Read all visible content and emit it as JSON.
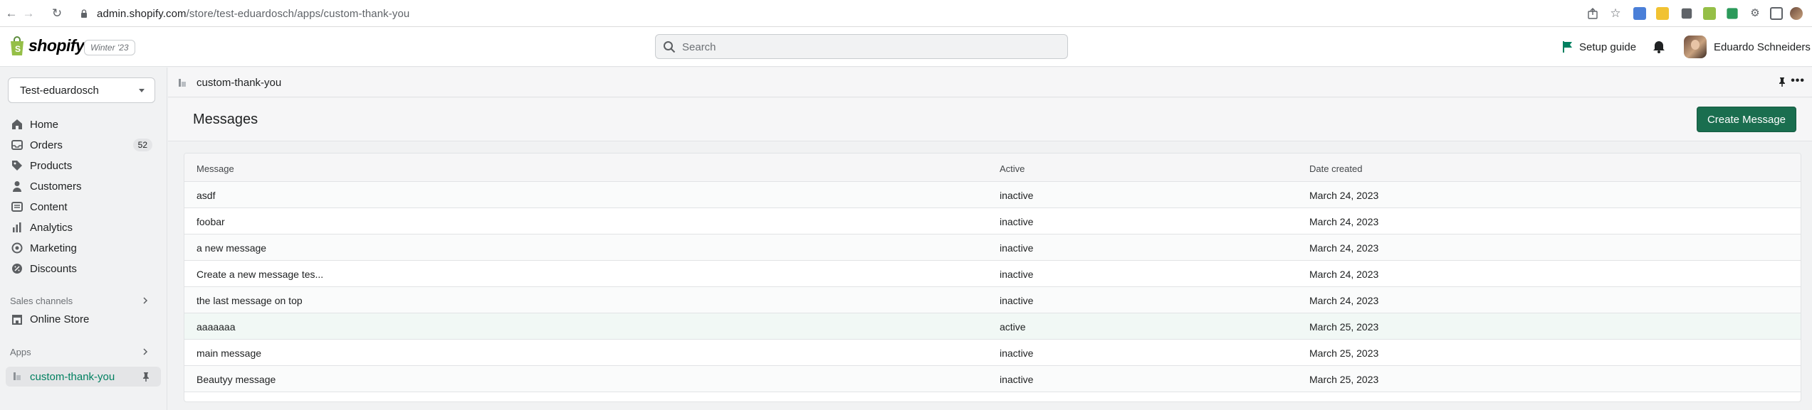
{
  "browser": {
    "url_host": "admin.shopify.com",
    "url_path": "/store/test-eduardosch/apps/custom-thank-you"
  },
  "topbar": {
    "logo_text": "shopify",
    "version_badge": "Winter '23",
    "search_placeholder": "Search",
    "setup_guide_label": "Setup guide",
    "user_name": "Eduardo Schneiders"
  },
  "sidebar": {
    "store_name": "Test-eduardosch",
    "items": [
      {
        "label": "Home",
        "icon": "home-icon"
      },
      {
        "label": "Orders",
        "icon": "orders-icon",
        "count": "52"
      },
      {
        "label": "Products",
        "icon": "tag-icon"
      },
      {
        "label": "Customers",
        "icon": "person-icon"
      },
      {
        "label": "Content",
        "icon": "content-icon"
      },
      {
        "label": "Analytics",
        "icon": "bar-chart-icon"
      },
      {
        "label": "Marketing",
        "icon": "target-icon"
      },
      {
        "label": "Discounts",
        "icon": "discount-icon"
      }
    ],
    "sales_channels_label": "Sales channels",
    "online_store_label": "Online Store",
    "apps_label": "Apps",
    "app_item_label": "custom-thank-you"
  },
  "main": {
    "app_breadcrumb": "custom-thank-you",
    "page_title": "Messages",
    "create_button": "Create Message",
    "columns": [
      "Message",
      "Active",
      "Date created"
    ],
    "rows": [
      {
        "message": "asdf",
        "active": "inactive",
        "date": "March 24, 2023"
      },
      {
        "message": "foobar",
        "active": "inactive",
        "date": "March 24, 2023"
      },
      {
        "message": "a new message",
        "active": "inactive",
        "date": "March 24, 2023"
      },
      {
        "message": "Create a new message tes...",
        "active": "inactive",
        "date": "March 24, 2023"
      },
      {
        "message": "the last message on top",
        "active": "inactive",
        "date": "March 24, 2023"
      },
      {
        "message": "aaaaaaa",
        "active": "active",
        "date": "March 25, 2023"
      },
      {
        "message": "main message",
        "active": "inactive",
        "date": "March 25, 2023"
      },
      {
        "message": "Beautyy message",
        "active": "inactive",
        "date": "March 25, 2023"
      }
    ]
  },
  "colors": {
    "primary_button": "#1a6e4f",
    "active_nav_text": "#008060",
    "page_bg": "#f1f2f3"
  }
}
